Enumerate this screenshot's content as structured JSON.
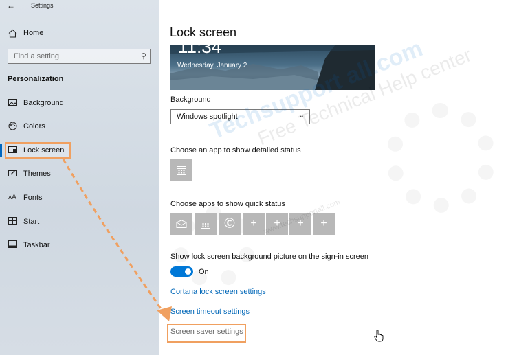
{
  "window": {
    "title": "Settings",
    "back_icon": "back-arrow-icon"
  },
  "sidebar": {
    "home_label": "Home",
    "search_placeholder": "Find a setting",
    "section_title": "Personalization",
    "items": [
      {
        "label": "Background",
        "icon": "background-image-icon"
      },
      {
        "label": "Colors",
        "icon": "palette-icon"
      },
      {
        "label": "Lock screen",
        "icon": "lock-screen-icon",
        "active": true
      },
      {
        "label": "Themes",
        "icon": "themes-icon"
      },
      {
        "label": "Fonts",
        "icon": "fonts-icon"
      },
      {
        "label": "Start",
        "icon": "start-icon"
      },
      {
        "label": "Taskbar",
        "icon": "taskbar-icon"
      }
    ]
  },
  "main": {
    "title": "Lock screen",
    "preview": {
      "time": "11:34",
      "date": "Wednesday, January 2"
    },
    "background_label": "Background",
    "background_value": "Windows spotlight",
    "detailed_status_label": "Choose an app to show detailed status",
    "quick_status_label": "Choose apps to show quick status",
    "signin_label": "Show lock screen background picture on the sign-in screen",
    "toggle_state": "On",
    "links": {
      "cortana": "Cortana lock screen settings",
      "timeout": "Screen timeout settings",
      "screensaver": "Screen saver settings"
    }
  },
  "watermark": {
    "brand": "Techsupport all.com",
    "tagline": "Free Technical Help center",
    "url": "www.techsupportall.com"
  },
  "colors": {
    "accent": "#0078d7",
    "link": "#0067b8",
    "annotation": "#f0a060"
  }
}
